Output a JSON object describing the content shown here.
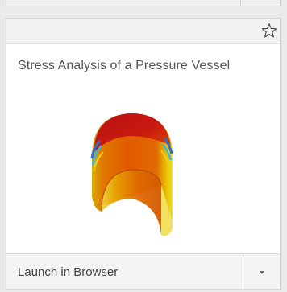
{
  "card": {
    "title": "Stress Analysis of a Pressure Vessel",
    "launch_label": "Launch in Browser"
  },
  "icons": {
    "favorite": "star-outline-icon",
    "dropdown": "caret-down-icon"
  },
  "colors": {
    "card_bg": "#ffffff",
    "header_bg": "#f2f2f2",
    "footer_bg": "#f4f4f4",
    "title_text": "#555555",
    "button_text": "#444444"
  }
}
